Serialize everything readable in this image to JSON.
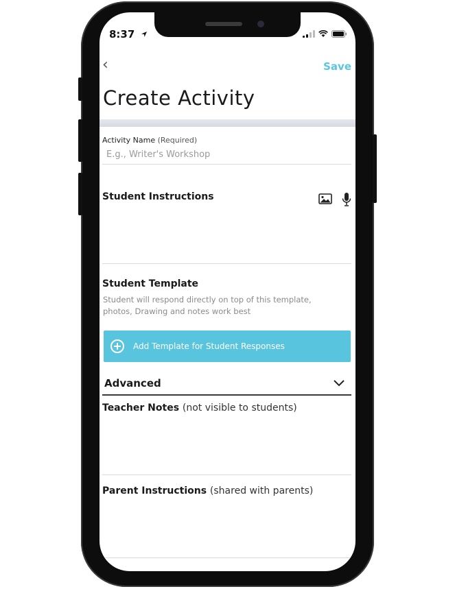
{
  "status_bar": {
    "time": "8:37",
    "location_icon": "location-arrow-icon",
    "signal_icon": "signal-bars-icon",
    "wifi_icon": "wifi-icon",
    "battery_icon": "battery-icon"
  },
  "nav": {
    "back_icon": "chevron-left-icon",
    "back_glyph": "‹",
    "save_label": "Save"
  },
  "page": {
    "title": "Create Activity"
  },
  "activity_name": {
    "label": "Activity Name",
    "required": "(Required)",
    "placeholder": "E.g., Writer's Workshop",
    "value": ""
  },
  "student_instructions": {
    "title": "Student Instructions",
    "image_icon": "image-icon",
    "mic_icon": "microphone-icon"
  },
  "student_template": {
    "title": "Student Template",
    "description": "Student will respond directly on top of this template, photos, Drawing and notes work best",
    "button_label": "Add Template for Student Responses",
    "button_icon": "plus-circle-icon"
  },
  "advanced": {
    "label": "Advanced",
    "icon": "chevron-down-icon"
  },
  "teacher_notes": {
    "title": "Teacher Notes",
    "note": "(not visible to students)"
  },
  "parent_instructions": {
    "title": "Parent Instructions",
    "note": "(shared with parents)"
  },
  "colors": {
    "accent": "#5bc5e0",
    "button_bg": "#58c4de",
    "phone_frame": "#0d0d0d"
  }
}
